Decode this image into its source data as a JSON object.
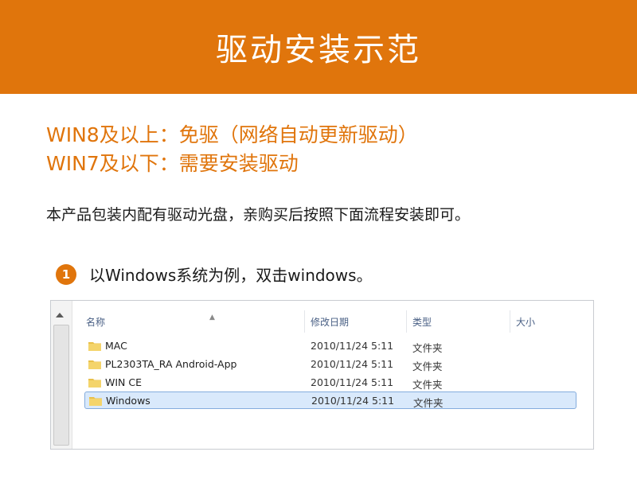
{
  "banner": {
    "title": "驱动安装示范"
  },
  "compat": {
    "line1": "WIN8及以上：免驱（网络自动更新驱动）",
    "line2": "WIN7及以下：需要安装驱动"
  },
  "intro": "本产品包装内配有驱动光盘，亲购买后按照下面流程安装即可。",
  "step": {
    "number": "1",
    "text": "以Windows系统为例，双击windows。"
  },
  "explorer": {
    "columns": {
      "name": "名称",
      "date": "修改日期",
      "type": "类型",
      "size": "大小"
    },
    "rows": [
      {
        "name": "MAC",
        "date": "2010/11/24 5:11",
        "type": "文件夹"
      },
      {
        "name": "PL2303TA_RA Android-App",
        "date": "2010/11/24 5:11",
        "type": "文件夹"
      },
      {
        "name": "WIN CE",
        "date": "2010/11/24 5:11",
        "type": "文件夹"
      },
      {
        "name": "Windows",
        "date": "2010/11/24 5:11",
        "type": "文件夹",
        "selected": true
      }
    ]
  },
  "colors": {
    "accent": "#e0750c",
    "selection": "#d9e9fb",
    "folder": "#e9c04a"
  }
}
